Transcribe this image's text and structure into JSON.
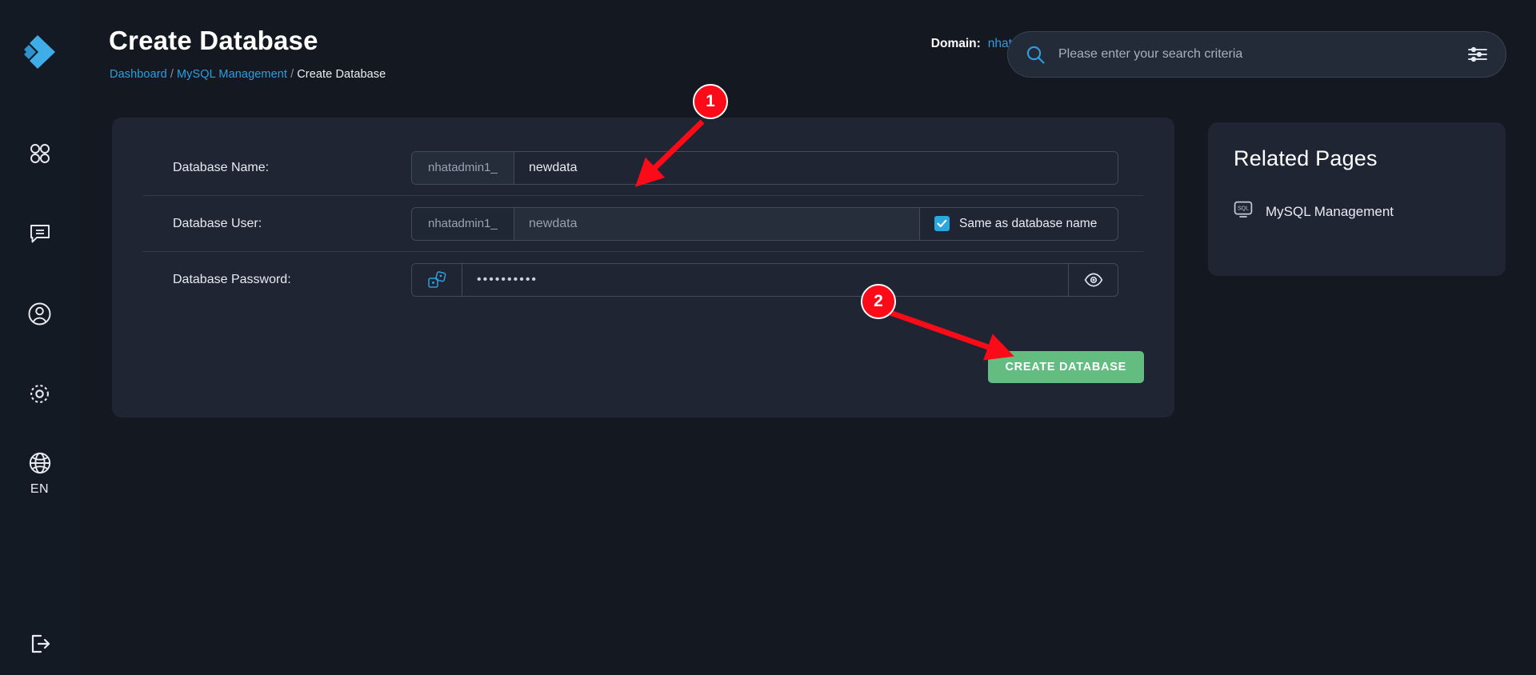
{
  "app": {
    "logo_icon": "double-chevron-logo",
    "background": "#131821",
    "accent_blue": "#2C9FE0",
    "accent_green": "#63BC80",
    "marker_red": "#FB0A17"
  },
  "sidebar": {
    "items": [
      {
        "id": "apps",
        "icon": "grid-apps-icon",
        "label": ""
      },
      {
        "id": "messages",
        "icon": "chat-bubble-icon",
        "label": ""
      },
      {
        "id": "account",
        "icon": "user-circle-icon",
        "label": ""
      },
      {
        "id": "settings",
        "icon": "gear-icon",
        "label": ""
      },
      {
        "id": "language",
        "icon": "globe-icon",
        "label": "EN"
      }
    ],
    "logout": {
      "icon": "logout-icon",
      "label": ""
    }
  },
  "header": {
    "title": "Create Database",
    "breadcrumb": [
      {
        "label": "Dashboard",
        "link": true
      },
      {
        "label": "MySQL Management",
        "link": true
      },
      {
        "label": "Create Database",
        "link": false
      }
    ],
    "separator": "/",
    "domain_label": "Domain:",
    "domain_value": "nhat.id.vn",
    "domain_caret_icon": "chevron-down-icon"
  },
  "search": {
    "icon": "search-icon",
    "placeholder": "Please enter your search criteria",
    "value": "",
    "filter_icon": "sliders-filter-icon"
  },
  "form": {
    "rows": [
      {
        "label": "Database Name:",
        "prefix": "nhatadmin1_",
        "value": "newdata",
        "disabled": false
      },
      {
        "label": "Database User:",
        "prefix": "nhatadmin1_",
        "value": "newdata",
        "disabled": true,
        "checkbox_label": "Same as database name",
        "checkbox_checked": true
      },
      {
        "label": "Database Password:",
        "value": "••••••••••",
        "generate_icon": "dice-icon",
        "reveal_icon": "eye-icon"
      }
    ],
    "submit_label": "CREATE DATABASE"
  },
  "related": {
    "title": "Related Pages",
    "items": [
      {
        "icon": "sql-screen-icon",
        "label": "MySQL Management"
      }
    ]
  },
  "annotations": [
    {
      "id": "marker-1",
      "number": "1"
    },
    {
      "id": "marker-2",
      "number": "2"
    }
  ]
}
